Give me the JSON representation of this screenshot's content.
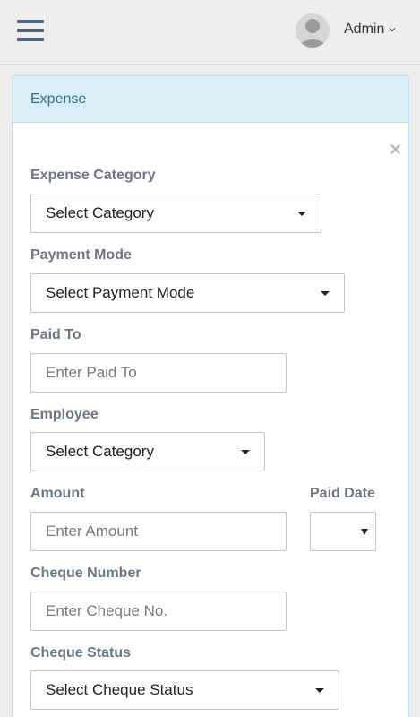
{
  "header": {
    "user_name": "Admin",
    "menu_icon": "hamburger-icon",
    "avatar_icon": "user-avatar-icon",
    "dropdown_icon": "chevron-down-icon"
  },
  "panel": {
    "title": "Expense",
    "close_label": "×"
  },
  "form": {
    "expense_category": {
      "label": "Expense Category",
      "value": "Select Category"
    },
    "payment_mode": {
      "label": "Payment Mode",
      "value": "Select Payment Mode"
    },
    "paid_to": {
      "label": "Paid To",
      "placeholder": "Enter Paid To"
    },
    "employee": {
      "label": "Employee",
      "value": "Select Category"
    },
    "amount": {
      "label": "Amount",
      "placeholder": "Enter Amount"
    },
    "paid_date": {
      "label": "Paid Date",
      "value": ""
    },
    "cheque_number": {
      "label": "Cheque Number",
      "placeholder": "Enter Cheque No."
    },
    "cheque_status": {
      "label": "Cheque Status",
      "value": "Select Cheque Status"
    }
  },
  "colors": {
    "heading_bg": "#d9edf7",
    "heading_text": "#31708f",
    "menu_icon": "#4d6680",
    "label_text": "#6b7785"
  }
}
